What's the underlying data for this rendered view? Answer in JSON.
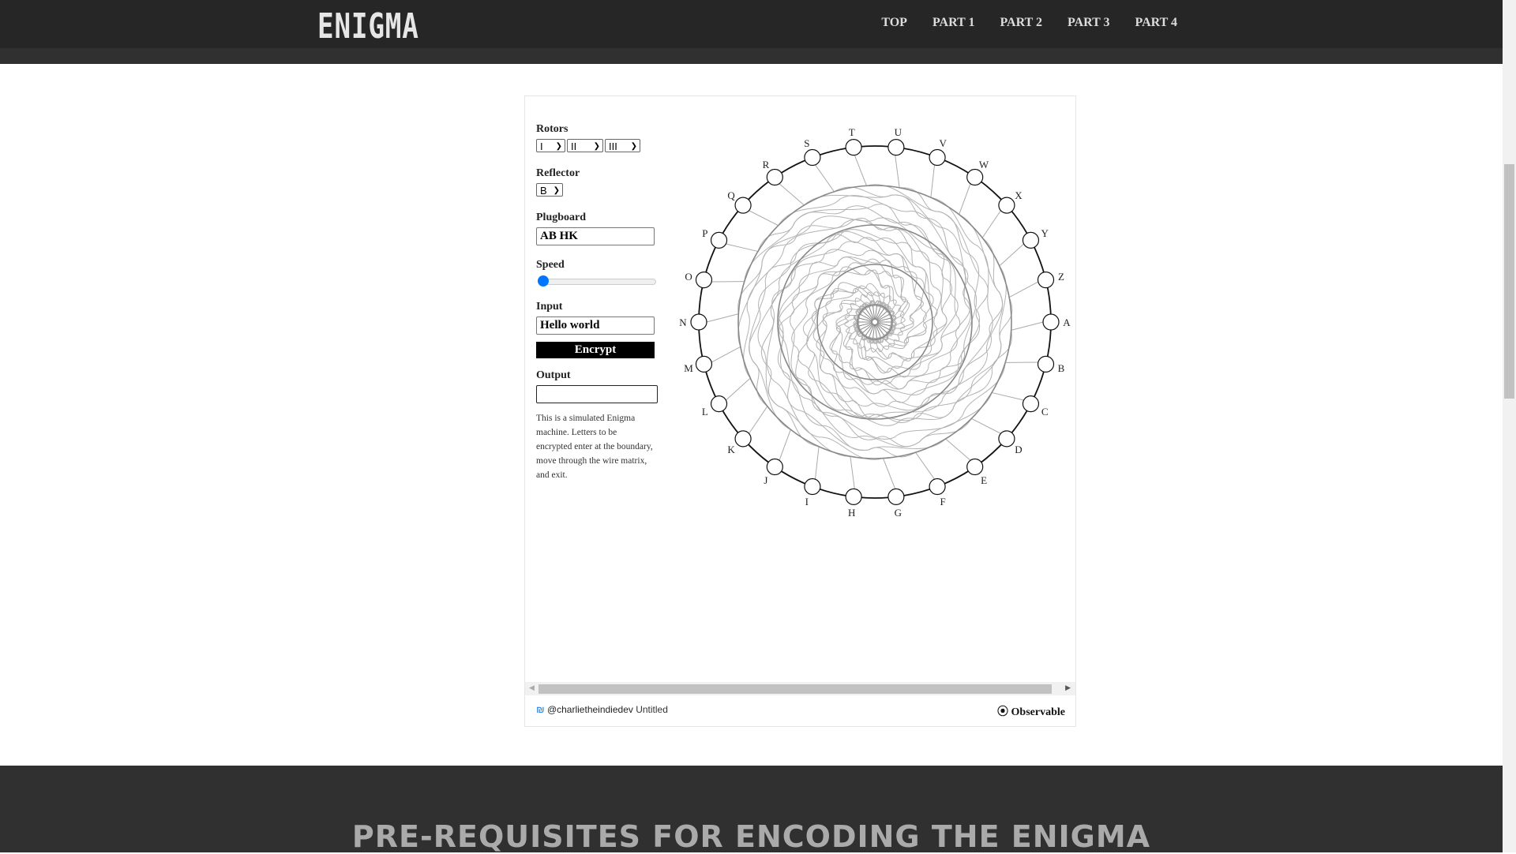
{
  "header": {
    "logo": "ENIGMA",
    "nav": [
      "TOP",
      "PART 1",
      "PART 2",
      "PART 3",
      "PART 4"
    ]
  },
  "controls": {
    "rotors_label": "Rotors",
    "rotors": [
      "I",
      "II",
      "III"
    ],
    "reflector_label": "Reflector",
    "reflector": "B",
    "plugboard_label": "Plugboard",
    "plugboard": "AB HK",
    "speed_label": "Speed",
    "speed": 0,
    "input_label": "Input",
    "input": "Hello world",
    "encrypt_label": "Encrypt",
    "output_label": "Output",
    "output": "",
    "description": "This is a simulated Enigma machine. Letters to be encrypted enter at the boundary, move through the wire matrix, and exit."
  },
  "diagram": {
    "letters": [
      "A",
      "B",
      "C",
      "D",
      "E",
      "F",
      "G",
      "H",
      "I",
      "J",
      "K",
      "L",
      "M",
      "N",
      "O",
      "P",
      "Q",
      "R",
      "S",
      "T",
      "U",
      "V",
      "W",
      "X",
      "Y",
      "Z"
    ]
  },
  "footer": {
    "user": "@charlietheindiedev",
    "notebook": "Untitled",
    "brand": "Observable"
  },
  "section": {
    "heading": "PRE-REQUISITES FOR ENCODING THE ENIGMA"
  }
}
